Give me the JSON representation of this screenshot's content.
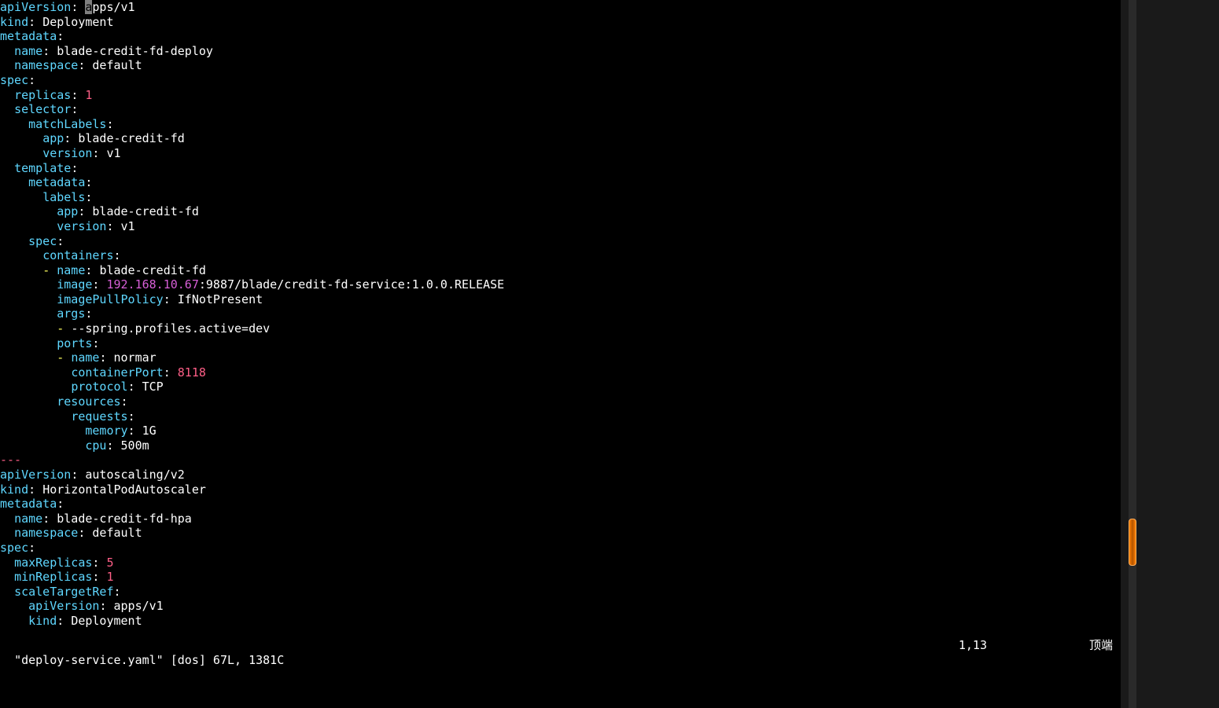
{
  "lines": [
    {
      "indent": 0,
      "segs": [
        {
          "cls": "key",
          "t": "apiVersion"
        },
        {
          "cls": "sep",
          "t": ": "
        },
        {
          "cls": "cursor",
          "t": "a"
        },
        {
          "cls": "str",
          "t": "pps/v1"
        }
      ]
    },
    {
      "indent": 0,
      "segs": [
        {
          "cls": "key",
          "t": "kind"
        },
        {
          "cls": "sep",
          "t": ": "
        },
        {
          "cls": "str",
          "t": "Deployment"
        }
      ]
    },
    {
      "indent": 0,
      "segs": [
        {
          "cls": "key",
          "t": "metadata"
        },
        {
          "cls": "sep",
          "t": ":"
        }
      ]
    },
    {
      "indent": 2,
      "segs": [
        {
          "cls": "key",
          "t": "name"
        },
        {
          "cls": "sep",
          "t": ": "
        },
        {
          "cls": "str",
          "t": "blade-credit-fd-deploy"
        }
      ]
    },
    {
      "indent": 2,
      "segs": [
        {
          "cls": "key",
          "t": "namespace"
        },
        {
          "cls": "sep",
          "t": ": "
        },
        {
          "cls": "str",
          "t": "default"
        }
      ]
    },
    {
      "indent": 0,
      "segs": [
        {
          "cls": "key",
          "t": "spec"
        },
        {
          "cls": "sep",
          "t": ":"
        }
      ]
    },
    {
      "indent": 2,
      "segs": [
        {
          "cls": "key",
          "t": "replicas"
        },
        {
          "cls": "sep",
          "t": ": "
        },
        {
          "cls": "num",
          "t": "1"
        }
      ]
    },
    {
      "indent": 2,
      "segs": [
        {
          "cls": "key",
          "t": "selector"
        },
        {
          "cls": "sep",
          "t": ":"
        }
      ]
    },
    {
      "indent": 4,
      "segs": [
        {
          "cls": "key",
          "t": "matchLabels"
        },
        {
          "cls": "sep",
          "t": ":"
        }
      ]
    },
    {
      "indent": 6,
      "segs": [
        {
          "cls": "key",
          "t": "app"
        },
        {
          "cls": "sep",
          "t": ": "
        },
        {
          "cls": "str",
          "t": "blade-credit-fd"
        }
      ]
    },
    {
      "indent": 6,
      "segs": [
        {
          "cls": "key",
          "t": "version"
        },
        {
          "cls": "sep",
          "t": ": "
        },
        {
          "cls": "str",
          "t": "v1"
        }
      ]
    },
    {
      "indent": 2,
      "segs": [
        {
          "cls": "key",
          "t": "template"
        },
        {
          "cls": "sep",
          "t": ":"
        }
      ]
    },
    {
      "indent": 4,
      "segs": [
        {
          "cls": "key",
          "t": "metadata"
        },
        {
          "cls": "sep",
          "t": ":"
        }
      ]
    },
    {
      "indent": 6,
      "segs": [
        {
          "cls": "key",
          "t": "labels"
        },
        {
          "cls": "sep",
          "t": ":"
        }
      ]
    },
    {
      "indent": 8,
      "segs": [
        {
          "cls": "key",
          "t": "app"
        },
        {
          "cls": "sep",
          "t": ": "
        },
        {
          "cls": "str",
          "t": "blade-credit-fd"
        }
      ]
    },
    {
      "indent": 8,
      "segs": [
        {
          "cls": "key",
          "t": "version"
        },
        {
          "cls": "sep",
          "t": ": "
        },
        {
          "cls": "str",
          "t": "v1"
        }
      ]
    },
    {
      "indent": 4,
      "segs": [
        {
          "cls": "key",
          "t": "spec"
        },
        {
          "cls": "sep",
          "t": ":"
        }
      ]
    },
    {
      "indent": 6,
      "segs": [
        {
          "cls": "key",
          "t": "containers"
        },
        {
          "cls": "sep",
          "t": ":"
        }
      ]
    },
    {
      "indent": 6,
      "segs": [
        {
          "cls": "dash",
          "t": "- "
        },
        {
          "cls": "key",
          "t": "name"
        },
        {
          "cls": "sep",
          "t": ": "
        },
        {
          "cls": "str",
          "t": "blade-credit-fd"
        }
      ]
    },
    {
      "indent": 8,
      "segs": [
        {
          "cls": "key",
          "t": "image"
        },
        {
          "cls": "sep",
          "t": ": "
        },
        {
          "cls": "ip",
          "t": "192.168.10.67"
        },
        {
          "cls": "str",
          "t": ":9887/blade/credit-fd-service:1.0.0.RELEASE"
        }
      ]
    },
    {
      "indent": 8,
      "segs": [
        {
          "cls": "key",
          "t": "imagePullPolicy"
        },
        {
          "cls": "sep",
          "t": ": "
        },
        {
          "cls": "str",
          "t": "IfNotPresent"
        }
      ]
    },
    {
      "indent": 8,
      "segs": [
        {
          "cls": "key",
          "t": "args"
        },
        {
          "cls": "sep",
          "t": ":"
        }
      ]
    },
    {
      "indent": 8,
      "segs": [
        {
          "cls": "dash",
          "t": "- "
        },
        {
          "cls": "str",
          "t": "--spring.profiles.active=dev"
        }
      ]
    },
    {
      "indent": 8,
      "segs": [
        {
          "cls": "key",
          "t": "ports"
        },
        {
          "cls": "sep",
          "t": ":"
        }
      ]
    },
    {
      "indent": 8,
      "segs": [
        {
          "cls": "dash",
          "t": "- "
        },
        {
          "cls": "key",
          "t": "name"
        },
        {
          "cls": "sep",
          "t": ": "
        },
        {
          "cls": "str",
          "t": "normar"
        }
      ]
    },
    {
      "indent": 10,
      "segs": [
        {
          "cls": "key",
          "t": "containerPort"
        },
        {
          "cls": "sep",
          "t": ": "
        },
        {
          "cls": "num",
          "t": "8118"
        }
      ]
    },
    {
      "indent": 10,
      "segs": [
        {
          "cls": "key",
          "t": "protocol"
        },
        {
          "cls": "sep",
          "t": ": "
        },
        {
          "cls": "str",
          "t": "TCP"
        }
      ]
    },
    {
      "indent": 8,
      "segs": [
        {
          "cls": "key",
          "t": "resources"
        },
        {
          "cls": "sep",
          "t": ":"
        }
      ]
    },
    {
      "indent": 10,
      "segs": [
        {
          "cls": "key",
          "t": "requests"
        },
        {
          "cls": "sep",
          "t": ":"
        }
      ]
    },
    {
      "indent": 12,
      "segs": [
        {
          "cls": "key",
          "t": "memory"
        },
        {
          "cls": "sep",
          "t": ": "
        },
        {
          "cls": "str",
          "t": "1G"
        }
      ]
    },
    {
      "indent": 12,
      "segs": [
        {
          "cls": "key",
          "t": "cpu"
        },
        {
          "cls": "sep",
          "t": ": "
        },
        {
          "cls": "str",
          "t": "500m"
        }
      ]
    },
    {
      "indent": 0,
      "segs": [
        {
          "cls": "num",
          "t": "---"
        }
      ]
    },
    {
      "indent": 0,
      "segs": [
        {
          "cls": "key",
          "t": "apiVersion"
        },
        {
          "cls": "sep",
          "t": ": "
        },
        {
          "cls": "str",
          "t": "autoscaling/v2"
        }
      ]
    },
    {
      "indent": 0,
      "segs": [
        {
          "cls": "key",
          "t": "kind"
        },
        {
          "cls": "sep",
          "t": ": "
        },
        {
          "cls": "str",
          "t": "HorizontalPodAutoscaler"
        }
      ]
    },
    {
      "indent": 0,
      "segs": [
        {
          "cls": "key",
          "t": "metadata"
        },
        {
          "cls": "sep",
          "t": ":"
        }
      ]
    },
    {
      "indent": 2,
      "segs": [
        {
          "cls": "key",
          "t": "name"
        },
        {
          "cls": "sep",
          "t": ": "
        },
        {
          "cls": "str",
          "t": "blade-credit-fd-hpa"
        }
      ]
    },
    {
      "indent": 2,
      "segs": [
        {
          "cls": "key",
          "t": "namespace"
        },
        {
          "cls": "sep",
          "t": ": "
        },
        {
          "cls": "str",
          "t": "default"
        }
      ]
    },
    {
      "indent": 0,
      "segs": [
        {
          "cls": "key",
          "t": "spec"
        },
        {
          "cls": "sep",
          "t": ":"
        }
      ]
    },
    {
      "indent": 2,
      "segs": [
        {
          "cls": "key",
          "t": "maxReplicas"
        },
        {
          "cls": "sep",
          "t": ": "
        },
        {
          "cls": "num",
          "t": "5"
        }
      ]
    },
    {
      "indent": 2,
      "segs": [
        {
          "cls": "key",
          "t": "minReplicas"
        },
        {
          "cls": "sep",
          "t": ": "
        },
        {
          "cls": "num",
          "t": "1"
        }
      ]
    },
    {
      "indent": 2,
      "segs": [
        {
          "cls": "key",
          "t": "scaleTargetRef"
        },
        {
          "cls": "sep",
          "t": ":"
        }
      ]
    },
    {
      "indent": 4,
      "segs": [
        {
          "cls": "key",
          "t": "apiVersion"
        },
        {
          "cls": "sep",
          "t": ": "
        },
        {
          "cls": "str",
          "t": "apps/v1"
        }
      ]
    },
    {
      "indent": 4,
      "segs": [
        {
          "cls": "key",
          "t": "kind"
        },
        {
          "cls": "sep",
          "t": ": "
        },
        {
          "cls": "str",
          "t": "Deployment"
        }
      ]
    }
  ],
  "status": {
    "left": "\"deploy-service.yaml\" [dos] 67L, 1381C",
    "pos": "1,13",
    "right": "顶端"
  }
}
